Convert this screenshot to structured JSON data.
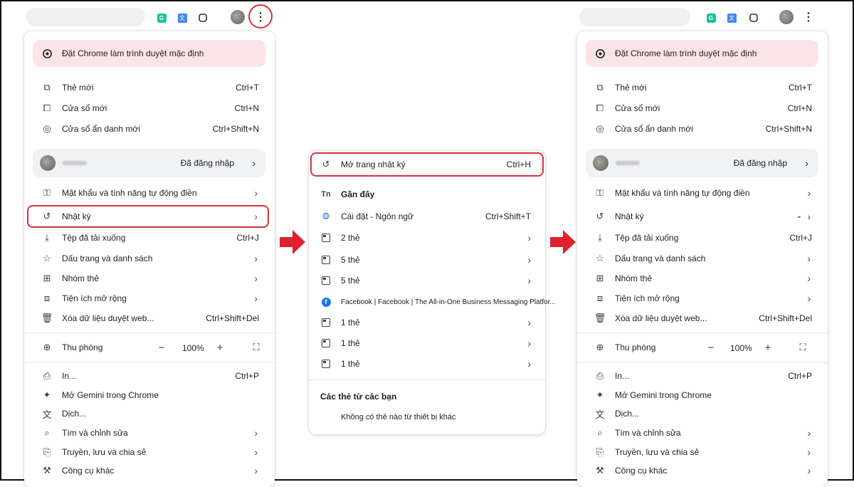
{
  "toolbar": {
    "kebab_icon": "vertical-dots-icon"
  },
  "main_menu": {
    "set_default": "Đặt Chrome làm trình duyệt mặc định",
    "new_tab": "Thẻ mới",
    "new_tab_sc": "Ctrl+T",
    "new_window": "Cửa sổ mới",
    "new_window_sc": "Ctrl+N",
    "incognito": "Cửa sổ ẩn danh mới",
    "incognito_sc": "Ctrl+Shift+N",
    "signed_in": "Đã đăng nhập",
    "passwords": "Mật khẩu và tính năng tự động điền",
    "history": "Nhật ký",
    "downloads": "Tệp đã tải xuống",
    "downloads_sc": "Ctrl+J",
    "bookmarks": "Dấu trang và danh sách",
    "tab_groups": "Nhóm thẻ",
    "extensions": "Tiện ích mở rộng",
    "clear_data": "Xóa dữ liệu duyệt web...",
    "clear_data_sc": "Ctrl+Shift+Del",
    "zoom": "Thu phóng",
    "zoom_minus": "−",
    "zoom_value": "100%",
    "zoom_plus": "+",
    "print": "In...",
    "print_sc": "Ctrl+P",
    "gemini": "Mở Gemini trong Chrome",
    "translate": "Dịch...",
    "find_edit": "Tìm và chỉnh sửa",
    "cast_save": "Truyền, lưu và chia sẻ",
    "more_tools": "Công cụ khác",
    "history_dash": "-"
  },
  "history_submenu": {
    "open_history": "Mở trang nhật ký",
    "open_history_sc": "Ctrl+H",
    "recent": "Gần đây",
    "items": [
      {
        "label": "Cài đặt - Ngôn ngữ",
        "sc": "Ctrl+Shift+T",
        "icon": "settings-gear-icon"
      },
      {
        "label": "2 thẻ",
        "icon": "tab-group-icon"
      },
      {
        "label": "5 thẻ",
        "icon": "tab-group-icon"
      },
      {
        "label": "5 thẻ",
        "icon": "tab-group-icon"
      },
      {
        "label": "Facebook | Facebook | The All-in-One Business Messaging Platfor...",
        "icon": "facebook-icon"
      },
      {
        "label": "1 thẻ",
        "icon": "tab-group-icon"
      },
      {
        "label": "1 thẻ",
        "icon": "tab-group-icon"
      },
      {
        "label": "1 thẻ",
        "icon": "tab-group-icon"
      }
    ],
    "tabs_from_devices": "Các thẻ từ các bạn",
    "no_tabs": "Không có thẻ nào từ thiết bị khác",
    "recent_icon_text": "Tn"
  },
  "colors": {
    "highlight": "#d9323b",
    "arrow": "#e0202e",
    "banner": "#fbe4e7"
  }
}
